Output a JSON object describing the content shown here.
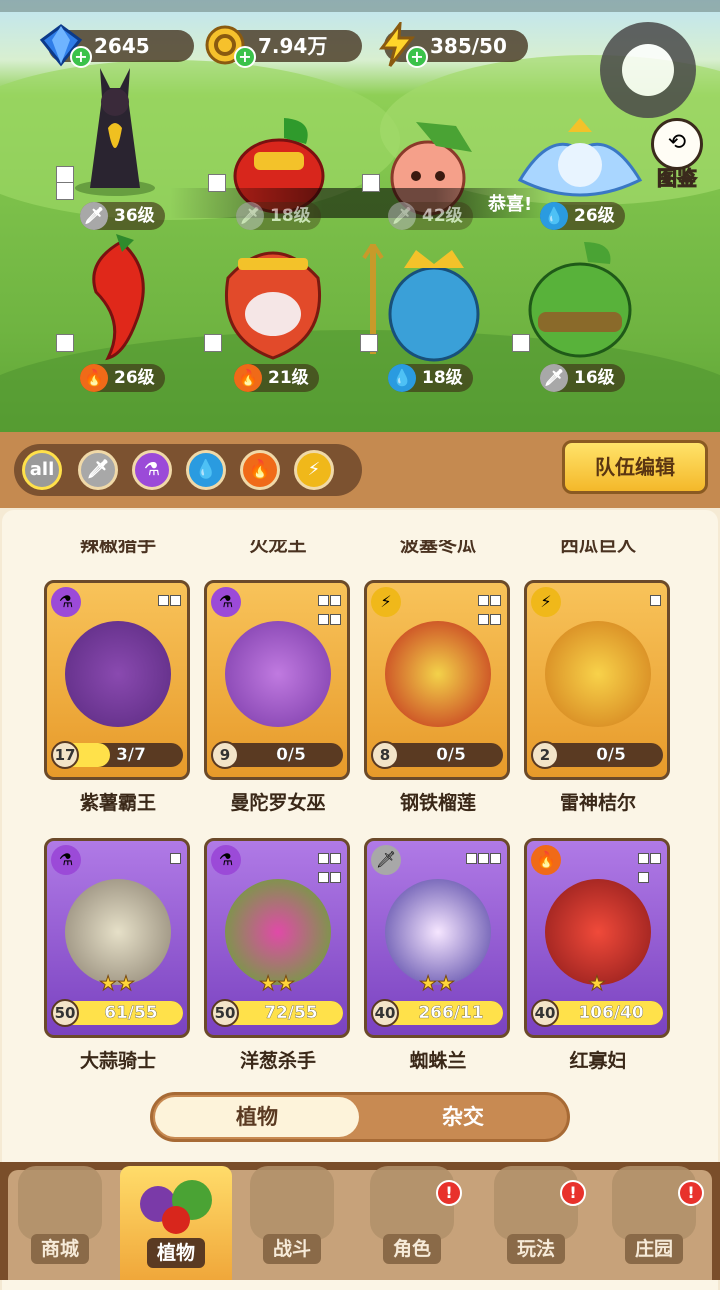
{
  "resources": [
    {
      "icon": "gem-icon",
      "value": "2645"
    },
    {
      "icon": "coin-icon",
      "value": "7.94万"
    },
    {
      "icon": "lightning-icon",
      "value": "385/50"
    }
  ],
  "atlas_label": "图鉴",
  "toast_text": "恭喜!",
  "team_plants": [
    {
      "level": "36级",
      "element": "sword"
    },
    {
      "level": "18级",
      "element": "sword"
    },
    {
      "level": "42级",
      "element": "sword"
    },
    {
      "level": "26级",
      "element": "water"
    },
    {
      "level": "26级",
      "element": "fire"
    },
    {
      "level": "21级",
      "element": "fire"
    },
    {
      "level": "18级",
      "element": "water"
    },
    {
      "level": "16级",
      "element": "sword"
    }
  ],
  "filters": [
    "all",
    "sword",
    "potion",
    "water",
    "fire",
    "lightning"
  ],
  "filter_all_label": "all",
  "team_edit_label": "队伍编辑",
  "partial_headers": [
    "辣椒猎手",
    "火龙王",
    "波塞冬瓜",
    "西瓜巨人"
  ],
  "cards": [
    {
      "name": "紫薯霸王",
      "level": "17",
      "progress": "3/7",
      "fill": 0.43,
      "rarity": "gold",
      "element": "potion"
    },
    {
      "name": "曼陀罗女巫",
      "level": "9",
      "progress": "0/5",
      "fill": 0,
      "rarity": "gold",
      "element": "potion"
    },
    {
      "name": "钢铁榴莲",
      "level": "8",
      "progress": "0/5",
      "fill": 0,
      "rarity": "gold",
      "element": "lightning"
    },
    {
      "name": "雷神桔尔",
      "level": "2",
      "progress": "0/5",
      "fill": 0,
      "rarity": "gold",
      "element": "lightning"
    },
    {
      "name": "大蒜骑士",
      "level": "50",
      "progress": "61/55",
      "fill": 1,
      "rarity": "purple",
      "element": "potion",
      "stars": "★★"
    },
    {
      "name": "洋葱杀手",
      "level": "50",
      "progress": "72/55",
      "fill": 1,
      "rarity": "purple",
      "element": "potion",
      "stars": "★★"
    },
    {
      "name": "蜘蛛兰",
      "level": "40",
      "progress": "266/11",
      "fill": 1,
      "rarity": "purple",
      "element": "sword",
      "stars": "★★"
    },
    {
      "name": "红寡妇",
      "level": "40",
      "progress": "106/40",
      "fill": 1,
      "rarity": "purple",
      "element": "fire",
      "stars": "★"
    }
  ],
  "segment": {
    "active": "植物",
    "inactive": "杂交"
  },
  "nav": [
    {
      "label": "商城",
      "badge": false
    },
    {
      "label": "植物",
      "badge": false,
      "active": true
    },
    {
      "label": "战斗",
      "badge": false
    },
    {
      "label": "角色",
      "badge": true
    },
    {
      "label": "玩法",
      "badge": true
    },
    {
      "label": "庄园",
      "badge": true
    }
  ],
  "badge_text": "!",
  "colors": {
    "sword": "#a8a8a8",
    "potion": "#9b4ad8",
    "water": "#2a9be0",
    "fire": "#f06a18",
    "lightning": "#f0b81a",
    "gold_card": "#f3b042",
    "purple_card": "#9a5ad6"
  }
}
